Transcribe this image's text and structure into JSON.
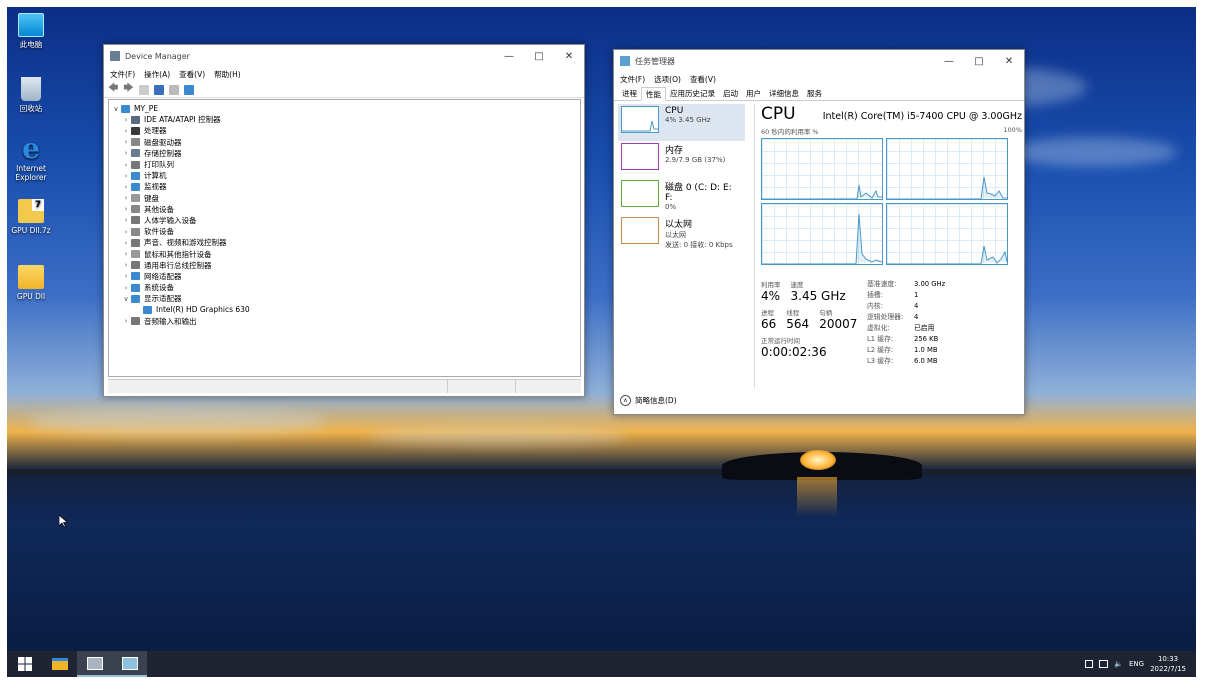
{
  "desktop": {
    "icons": [
      {
        "label": "此电脑",
        "icon": "computer-icon"
      },
      {
        "label": "回收站",
        "icon": "recycle-bin-icon"
      },
      {
        "label": "Internet\nExplorer",
        "icon": "ie-icon"
      },
      {
        "label": "GPU Dll.7z",
        "icon": "archive-icon"
      },
      {
        "label": "GPU Dll",
        "icon": "folder-icon"
      }
    ]
  },
  "device_manager": {
    "title": "Device Manager",
    "menu": [
      "文件(F)",
      "操作(A)",
      "查看(V)",
      "帮助(H)"
    ],
    "root": "MY_PE",
    "nodes": [
      {
        "label": "IDE ATA/ATAPI 控制器",
        "expanded": false,
        "color": "#5a6a80"
      },
      {
        "label": "处理器",
        "expanded": false,
        "color": "#3a3a3a"
      },
      {
        "label": "磁盘驱动器",
        "expanded": false,
        "color": "#888"
      },
      {
        "label": "存储控制器",
        "expanded": false,
        "color": "#6a7a90"
      },
      {
        "label": "打印队列",
        "expanded": false,
        "color": "#777"
      },
      {
        "label": "计算机",
        "expanded": false,
        "color": "#3a8ad0"
      },
      {
        "label": "监视器",
        "expanded": false,
        "color": "#3a8ad0"
      },
      {
        "label": "键盘",
        "expanded": false,
        "color": "#999"
      },
      {
        "label": "其他设备",
        "expanded": false,
        "color": "#888"
      },
      {
        "label": "人体学输入设备",
        "expanded": false,
        "color": "#777"
      },
      {
        "label": "软件设备",
        "expanded": false,
        "color": "#888"
      },
      {
        "label": "声音、视频和游戏控制器",
        "expanded": false,
        "color": "#777"
      },
      {
        "label": "鼠标和其他指针设备",
        "expanded": false,
        "color": "#999"
      },
      {
        "label": "通用串行总线控制器",
        "expanded": false,
        "color": "#777"
      },
      {
        "label": "网络适配器",
        "expanded": false,
        "color": "#3a8ad0"
      },
      {
        "label": "系统设备",
        "expanded": false,
        "color": "#3a8ad0"
      },
      {
        "label": "显示适配器",
        "expanded": true,
        "color": "#3a8ad0"
      },
      {
        "label": "Intel(R) HD Graphics 630",
        "child": true,
        "color": "#3a8ad0"
      },
      {
        "label": "音频输入和输出",
        "expanded": false,
        "color": "#777"
      }
    ]
  },
  "task_manager": {
    "title": "任务管理器",
    "menu": [
      "文件(F)",
      "选项(O)",
      "查看(V)"
    ],
    "tabs": [
      "进程",
      "性能",
      "应用历史记录",
      "启动",
      "用户",
      "详细信息",
      "服务"
    ],
    "active_tab": "性能",
    "side": [
      {
        "name": "CPU",
        "detail": "4% 3.45 GHz",
        "color": "#4a98c8"
      },
      {
        "name": "内存",
        "detail": "2.9/7.9 GB (37%)",
        "color": "#a040b0"
      },
      {
        "name": "磁盘 0 (C: D: E: F:",
        "detail": "0%",
        "color": "#60b040"
      },
      {
        "name": "以太网",
        "detail": "以太网",
        "detail2": "发送: 0  接收: 0 Kbps",
        "color": "#c08a50"
      }
    ],
    "cpu": {
      "title": "CPU",
      "name": "Intel(R) Core(TM) i5-7400 CPU @ 3.00GHz",
      "graph_label": "60 秒内的利用率 %",
      "graph_max": "100%",
      "utilization_label": "利用率",
      "utilization": "4%",
      "speed_label": "速度",
      "speed": "3.45 GHz",
      "processes_label": "进程",
      "processes": "66",
      "threads_label": "线程",
      "threads": "564",
      "handles_label": "句柄",
      "handles": "20007",
      "uptime_label": "正常运行时间",
      "uptime": "0:00:02:36",
      "specs": [
        {
          "k": "基准速度:",
          "v": "3.00 GHz"
        },
        {
          "k": "插槽:",
          "v": "1"
        },
        {
          "k": "内核:",
          "v": "4"
        },
        {
          "k": "逻辑处理器:",
          "v": "4"
        },
        {
          "k": "虚拟化:",
          "v": "已启用"
        },
        {
          "k": "L1 缓存:",
          "v": "256 KB"
        },
        {
          "k": "L2 缓存:",
          "v": "1.0 MB"
        },
        {
          "k": "L3 缓存:",
          "v": "6.0 MB"
        }
      ]
    },
    "brief": "简略信息(D)"
  },
  "taskbar": {
    "lang": "ENG",
    "time": "10:33",
    "date": "2022/7/15"
  }
}
